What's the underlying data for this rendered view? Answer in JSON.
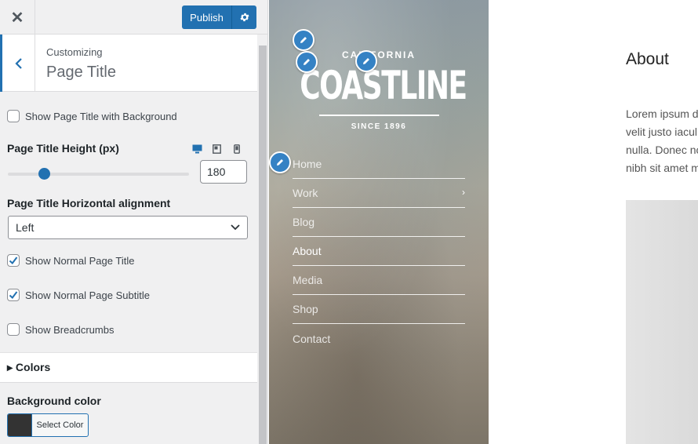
{
  "topbar": {
    "close_icon": "close-icon",
    "publish_label": "Publish",
    "settings_icon": "gear-icon",
    "accent": "#2271b1"
  },
  "section": {
    "crumb": "Customizing",
    "title": "Page Title"
  },
  "controls": {
    "show_bg": {
      "label": "Show Page Title with Background",
      "checked": false
    },
    "height": {
      "title": "Page Title Height (px)",
      "value": "180",
      "slider_fraction": 0.2,
      "devices": [
        "desktop-icon",
        "tablet-icon",
        "mobile-icon"
      ]
    },
    "alignment": {
      "title": "Page Title Horizontal alignment",
      "selected": "Left"
    },
    "show_title": {
      "label": "Show Normal Page Title",
      "checked": true
    },
    "show_subtitle": {
      "label": "Show Normal Page Subtitle",
      "checked": true
    },
    "show_breadcrumbs": {
      "label": "Show Breadcrumbs",
      "checked": false
    },
    "colors_section": "▸ Colors",
    "bg_color": {
      "title": "Background color",
      "button_label": "Select Color",
      "swatch": "#333333"
    }
  },
  "preview": {
    "logo": {
      "top": "CALIFORNIA",
      "main": "COASTLINE",
      "bottom": "SINCE 1896"
    },
    "menu": [
      {
        "label": "Home",
        "active": false,
        "has_children": false
      },
      {
        "label": "Work",
        "active": false,
        "has_children": true
      },
      {
        "label": "Blog",
        "active": false,
        "has_children": false
      },
      {
        "label": "About",
        "active": true,
        "has_children": false
      },
      {
        "label": "Media",
        "active": false,
        "has_children": false
      },
      {
        "label": "Shop",
        "active": false,
        "has_children": false
      },
      {
        "label": "Contact",
        "active": false,
        "has_children": false
      }
    ],
    "page_heading": "About",
    "page_text": [
      "Lorem ipsum d",
      "velit justo iacul",
      "nulla. Donec no",
      "nibh sit amet m"
    ]
  }
}
